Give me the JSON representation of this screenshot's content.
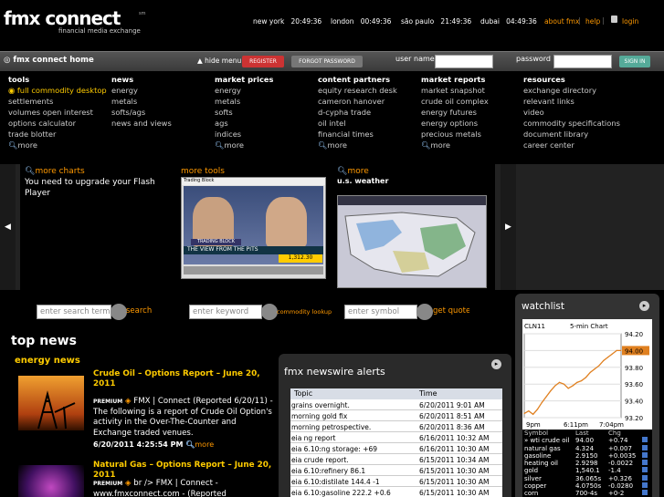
{
  "logo": {
    "text": "fmx connect",
    "tm": "sm",
    "sub": "financial media exchange"
  },
  "clocks": [
    {
      "city": "new york",
      "time": "20:49:36"
    },
    {
      "city": "london",
      "time": "00:49:36"
    },
    {
      "city": "são paulo",
      "time": "21:49:36"
    },
    {
      "city": "dubai",
      "time": "04:49:36"
    }
  ],
  "toplinks": {
    "about": "about fmx",
    "help": "help",
    "login": "login"
  },
  "nav": {
    "home": "fmx connect home",
    "hide": "hide menu",
    "register": "REGISTER",
    "forgot": "FORGOT PASSWORD",
    "user_label": "user name",
    "pass_label": "password",
    "signin": "SIGN IN"
  },
  "menu": [
    {
      "heading": "tools",
      "items": [
        "full commodity desktop",
        "settlements",
        "volumes open interest",
        "options calculator",
        "trade blotter"
      ],
      "more": "more"
    },
    {
      "heading": "news",
      "items": [
        "energy",
        "metals",
        "softs/ags",
        "news and views"
      ],
      "more": ""
    },
    {
      "heading": "market prices",
      "items": [
        "energy",
        "metals",
        "softs",
        "ags",
        "indices"
      ],
      "more": "more"
    },
    {
      "heading": "content partners",
      "items": [
        "equity research desk",
        "cameron hanover",
        "d-cypha trade",
        "oil intel",
        "financial times"
      ],
      "more": "more"
    },
    {
      "heading": "market reports",
      "items": [
        "market snapshot",
        "crude oil complex",
        "energy futures",
        "energy options",
        "precious metals"
      ],
      "more": "more"
    },
    {
      "heading": "resources",
      "items": [
        "exchange directory",
        "relevant links",
        "video",
        "commodity specifications",
        "document library",
        "career center"
      ],
      "more": "more"
    }
  ],
  "carousel": {
    "charts_title": "more charts",
    "flash_msg": "You need to upgrade your Flash Player",
    "tools_title": "more tools",
    "video": {
      "header": "Trading Block",
      "banner": "TRADING BLOCK",
      "caption": "THE VIEW FROM THE PITS",
      "ticker": "1,312.30"
    },
    "weather_more": "more",
    "weather_title": "u.s. weather"
  },
  "search": {
    "search_ph": "enter search term",
    "search_btn": "search",
    "keyword_ph": "enter keyword",
    "keyword_btn": "commodity lookup",
    "symbol_ph": "enter symbol",
    "symbol_btn": "get quote"
  },
  "top_news": {
    "title": "top news",
    "section": "energy news",
    "articles": [
      {
        "title": "Crude Oil – Options Report – June 20, 2011",
        "brand": "PREMIUM",
        "body": "FMX | Connect (Reported 6/20/11) - The following is a report of Crude Oil Option's activity in the Over-The-Counter and Exchange traded venues.",
        "date": "6/20/2011 4:25:54 PM",
        "more": "more"
      },
      {
        "title": "Natural Gas – Options Report – June 20, 2011",
        "brand": "PREMIUM",
        "body": "br /> FMX | Connect - www.fmxconnect.com - (Reported",
        "date": "",
        "more": ""
      }
    ]
  },
  "newswire": {
    "title": "fmx newswire alerts",
    "cols": [
      "Topic",
      "Time"
    ],
    "rows": [
      [
        "grains overnight.",
        "6/20/2011 9:01 AM"
      ],
      [
        "morning gold fix",
        "6/20/2011 8:51 AM"
      ],
      [
        "morning petrospective.",
        "6/20/2011 8:36 AM"
      ],
      [
        "eia ng report",
        "6/16/2011 10:32 AM"
      ],
      [
        "eia 6.10:ng storage: +69",
        "6/16/2011 10:30 AM"
      ],
      [
        "eia crude report.",
        "6/15/2011 10:34 AM"
      ],
      [
        "eia 6.10:refinery 86.1",
        "6/15/2011 10:30 AM"
      ],
      [
        "eia 6.10:distilate 144.4 -1",
        "6/15/2011 10:30 AM"
      ],
      [
        "eia 6.10:gasoline 222.2 +0.6",
        "6/15/2011 10:30 AM"
      ]
    ]
  },
  "watchlist": {
    "title": "watchlist",
    "chart_symbol": "CLN11",
    "chart_label": "5-min Chart",
    "yticks": [
      "94.20",
      "94.00",
      "93.80",
      "93.60",
      "93.40",
      "93.20"
    ],
    "xticks": [
      "9pm",
      "6:11pm",
      "7:04pm"
    ],
    "current": "94.00",
    "cols": [
      "Symbol",
      "Last",
      "Chg"
    ],
    "quotes": [
      [
        "» wti crude oil",
        "94.00",
        "+0.74"
      ],
      [
        "natural gas",
        "4.324",
        "+0.007"
      ],
      [
        "gasoline",
        "2.9150",
        "+0.0035"
      ],
      [
        "heating oil",
        "2.9298",
        "-0.0022"
      ],
      [
        "gold",
        "1,540.1",
        "-1.4"
      ],
      [
        "silver",
        "36.065s",
        "+0.326"
      ],
      [
        "copper",
        "4.0750s",
        "-0.0280"
      ],
      [
        "corn",
        "700-4s",
        "+0-2"
      ]
    ]
  },
  "chart_data": {
    "type": "line",
    "title": "5-min Chart",
    "series": [
      {
        "name": "CLN11",
        "values": [
          93.25,
          93.28,
          93.24,
          93.3,
          93.38,
          93.45,
          93.52,
          93.58,
          93.62,
          93.6,
          93.55,
          93.58,
          93.62,
          93.64,
          93.68,
          93.74,
          93.78,
          93.82,
          93.88,
          93.92,
          93.96,
          94.0,
          94.0
        ]
      }
    ],
    "ylim": [
      93.2,
      94.2
    ]
  }
}
